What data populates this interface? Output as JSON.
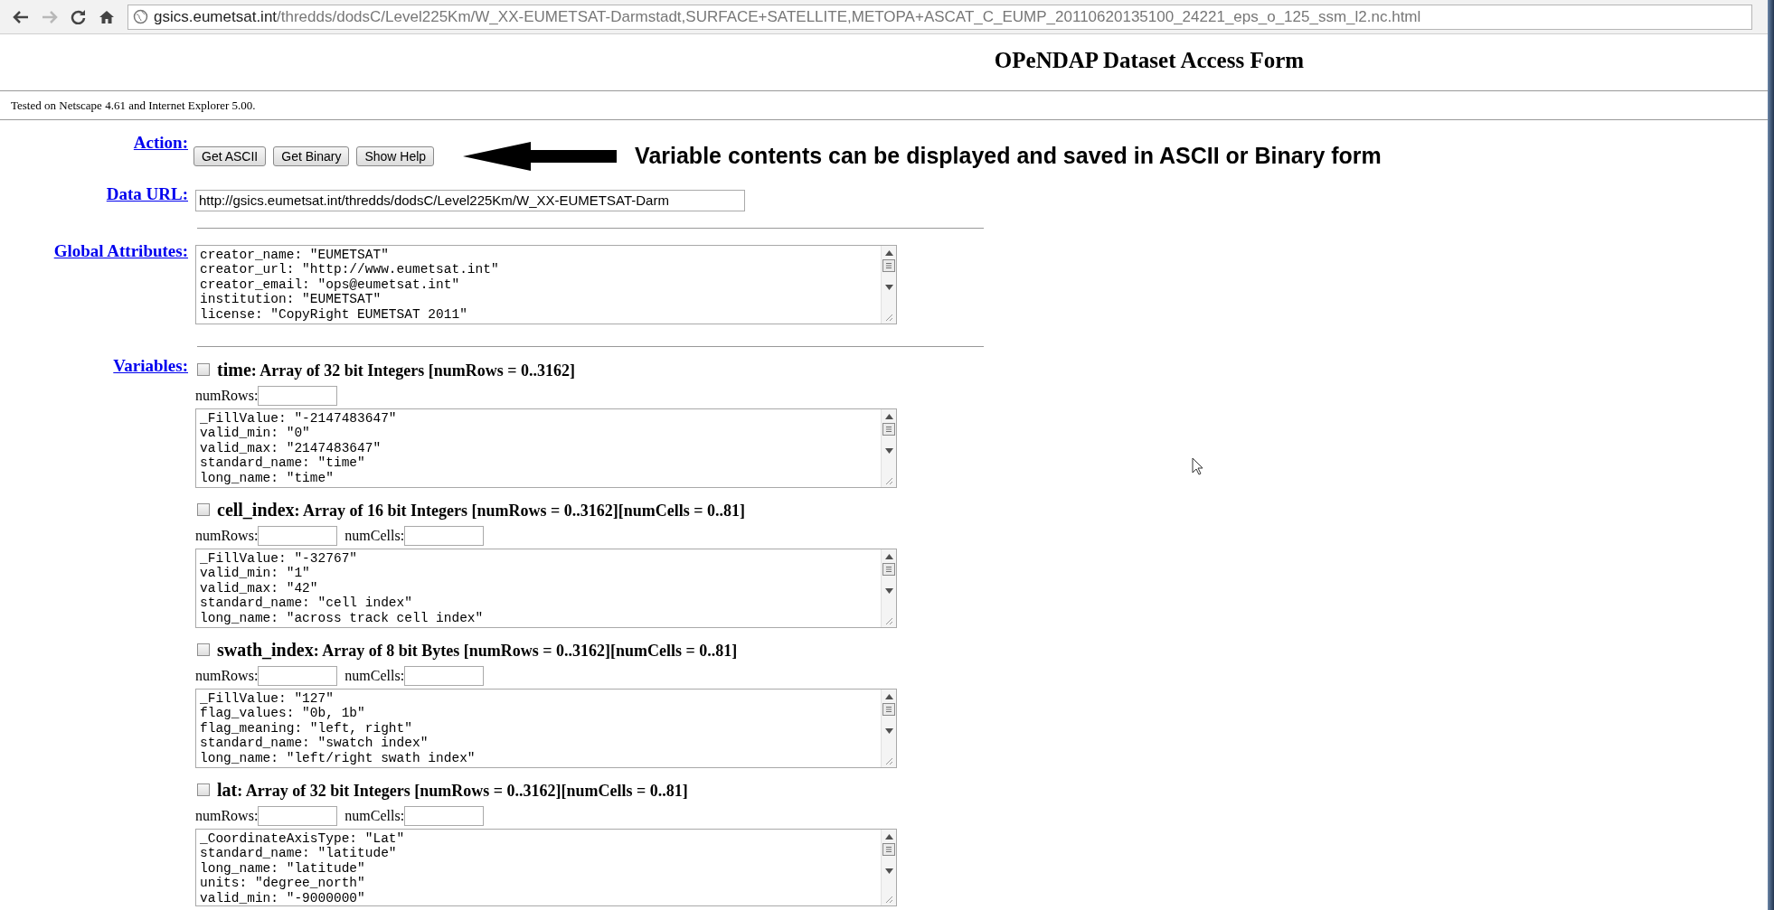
{
  "browser": {
    "url_host": "gsics.eumetsat.int",
    "url_path": "/thredds/dodsC/Level225Km/W_XX-EUMETSAT-Darmstadt,SURFACE+SATELLITE,METOPA+ASCAT_C_EUMP_20110620135100_24221_eps_o_125_ssm_l2.nc.html",
    "forward_disabled": true
  },
  "title": "OPeNDAP Dataset Access Form",
  "tested_note": "Tested on Netscape 4.61 and Internet Explorer 5.00.",
  "action": {
    "label": "Action:",
    "buttons": [
      "Get ASCII",
      "Get Binary",
      "Show Help"
    ],
    "callout": "Variable contents can be displayed and saved in ASCII or Binary form"
  },
  "data_url": {
    "label": "Data URL:",
    "value": "http://gsics.eumetsat.int/thredds/dodsC/Level225Km/W_XX-EUMETSAT-Darm"
  },
  "global_attributes": {
    "label": "Global Attributes:",
    "lines": [
      "creator_name: \"EUMETSAT\"",
      "creator_url: \"http://www.eumetsat.int\"",
      "creator_email: \"ops@eumetsat.int\"",
      "institution: \"EUMETSAT\"",
      "license: \"CopyRight EUMETSAT 2011\""
    ]
  },
  "variables": {
    "label": "Variables:",
    "items": [
      {
        "name": "time",
        "description": ": Array of 32 bit Integers [numRows = 0..3162]",
        "checked": false,
        "fields": [
          "numRows:"
        ],
        "lines": [
          "_FillValue: \"-2147483647\"",
          "valid_min: \"0\"",
          "valid_max: \"2147483647\"",
          "standard_name: \"time\"",
          "long_name: \"time\""
        ]
      },
      {
        "name": "cell_index",
        "description": ": Array of 16 bit Integers [numRows = 0..3162][numCells = 0..81]",
        "checked": false,
        "fields": [
          "numRows:",
          "numCells:"
        ],
        "lines": [
          "_FillValue: \"-32767\"",
          "valid_min: \"1\"",
          "valid_max: \"42\"",
          "standard_name: \"cell index\"",
          "long_name: \"across track cell index\""
        ]
      },
      {
        "name": "swath_index",
        "description": ": Array of 8 bit Bytes [numRows = 0..3162][numCells = 0..81]",
        "checked": false,
        "fields": [
          "numRows:",
          "numCells:"
        ],
        "lines": [
          "_FillValue: \"127\"",
          "flag_values: \"0b, 1b\"",
          "flag_meaning: \"left, right\"",
          "standard_name: \"swatch index\"",
          "long_name: \"left/right swath index\""
        ]
      },
      {
        "name": "lat",
        "description": ": Array of 32 bit Integers [numRows = 0..3162][numCells = 0..81]",
        "checked": false,
        "fields": [
          "numRows:",
          "numCells:"
        ],
        "lines": [
          "_CoordinateAxisType: \"Lat\"",
          "standard_name: \"latitude\"",
          "long_name: \"latitude\"",
          "units: \"degree_north\"",
          "valid_min: \"-9000000\""
        ]
      }
    ]
  }
}
